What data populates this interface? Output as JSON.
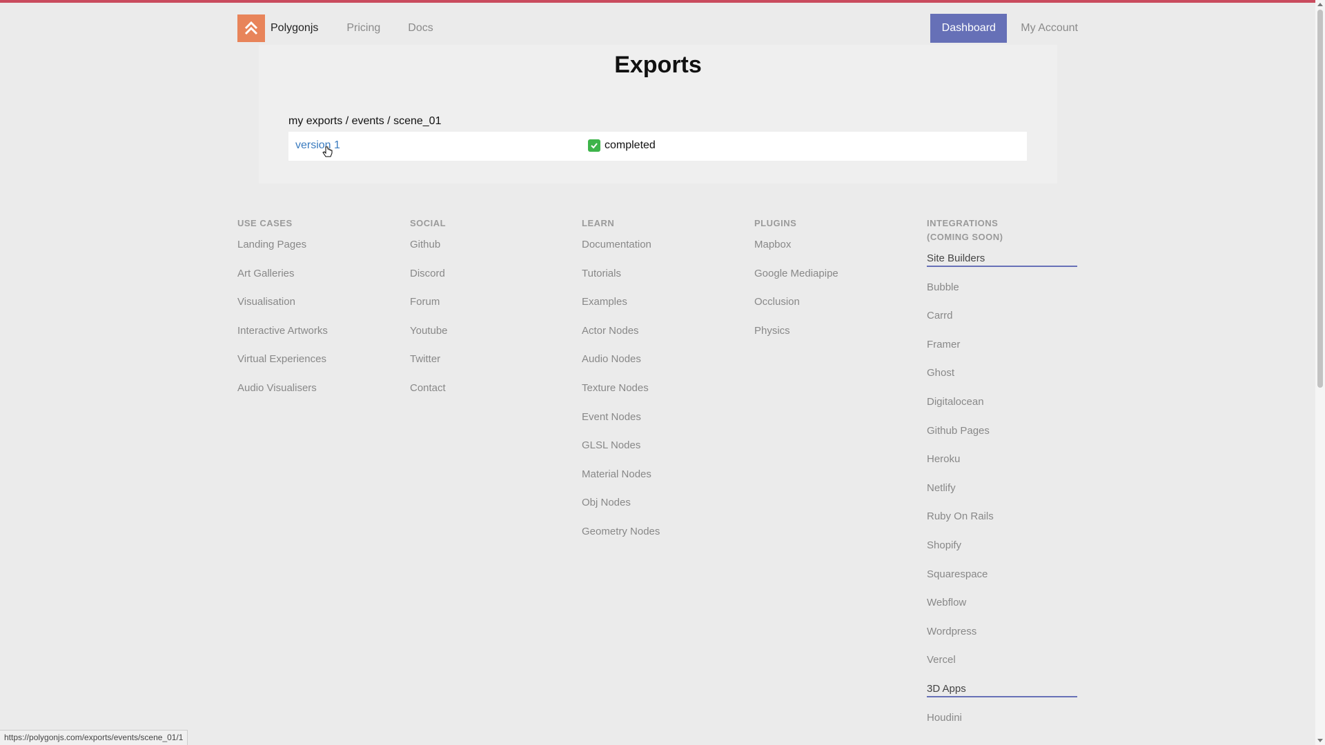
{
  "header": {
    "brand": "Polygonjs",
    "nav": [
      "Pricing",
      "Docs"
    ],
    "dashboard": "Dashboard",
    "account": "My Account"
  },
  "main": {
    "title": "Exports",
    "breadcrumb": [
      "my exports",
      "events",
      "scene_01"
    ],
    "breadcrumb_sep": " / ",
    "rows": [
      {
        "name": "version 1",
        "status": "completed"
      }
    ]
  },
  "footer": {
    "use_cases": {
      "heading": "USE CASES",
      "items": [
        "Landing Pages",
        "Art Galleries",
        "Visualisation",
        "Interactive Artworks",
        "Virtual Experiences",
        "Audio Visualisers"
      ]
    },
    "social": {
      "heading": "SOCIAL",
      "items": [
        "Github",
        "Discord",
        "Forum",
        "Youtube",
        "Twitter",
        "Contact"
      ]
    },
    "learn": {
      "heading": "LEARN",
      "items": [
        "Documentation",
        "Tutorials",
        "Examples",
        "Actor Nodes",
        "Audio Nodes",
        "Texture Nodes",
        "Event Nodes",
        "GLSL Nodes",
        "Material Nodes",
        "Obj Nodes",
        "Geometry Nodes"
      ]
    },
    "plugins": {
      "heading": "PLUGINS",
      "items": [
        "Mapbox",
        "Google Mediapipe",
        "Occlusion",
        "Physics"
      ]
    },
    "integrations": {
      "heading_line1": "INTEGRATIONS",
      "heading_line2": "(COMING SOON)",
      "section1": "Site Builders",
      "items1": [
        "Bubble",
        "Carrd",
        "Framer",
        "Ghost",
        "Digitalocean",
        "Github Pages",
        "Heroku",
        "Netlify",
        "Ruby On Rails",
        "Shopify",
        "Squarespace",
        "Webflow",
        "Wordpress",
        "Vercel"
      ],
      "section2": "3D Apps",
      "items2": [
        "Houdini"
      ]
    }
  },
  "status_url": "https://polygonjs.com/exports/events/scene_01/1",
  "colors": {
    "accent": "#6670b7",
    "logo": "#e8845a",
    "link": "#3a7bbf",
    "check": "#3db44a",
    "topline": "#c94b5e"
  }
}
